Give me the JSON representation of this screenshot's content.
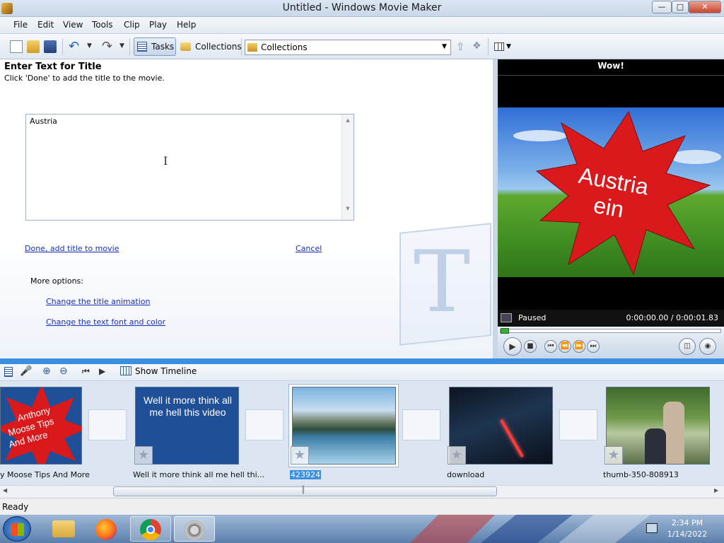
{
  "window": {
    "title": "Untitled - Windows Movie Maker"
  },
  "menu": [
    "File",
    "Edit",
    "View",
    "Tools",
    "Clip",
    "Play",
    "Help"
  ],
  "toolbar": {
    "tasks_label": "Tasks",
    "collections_label": "Collections",
    "dropdown_value": "Collections"
  },
  "title_task": {
    "heading": "Enter Text for Title",
    "instruction": "Click 'Done' to add the title to the movie.",
    "text_value": "Austria",
    "done_link": "Done, add title to movie",
    "cancel_link": "Cancel",
    "more_options_label": "More options:",
    "option_animation": "Change the title animation",
    "option_font": "Change the text font and color"
  },
  "preview": {
    "clip_title": "Wow!",
    "overlay_line1": "Austria",
    "overlay_line2": "ein",
    "status": "Paused",
    "time": "0:00:00.00 / 0:00:01.83",
    "seek_fraction": 0.0
  },
  "storyboard": {
    "show_timeline_label": "Show Timeline",
    "clips": [
      {
        "label": "y Moose Tips And More",
        "thumb_text": "Anthony Moose Tips And More"
      },
      {
        "label": "Well it more think all me hell thi...",
        "thumb_text": "Well it more think all me hell this video"
      },
      {
        "label": "423924"
      },
      {
        "label": "download"
      },
      {
        "label": "thumb-350-808913"
      }
    ]
  },
  "status_line": "Ready",
  "clock": {
    "time": "2:34 PM",
    "date": "1/14/2022"
  },
  "colors": {
    "accent": "#3a8fe0",
    "link": "#1a2fb8",
    "starburst": "#d9191c"
  }
}
